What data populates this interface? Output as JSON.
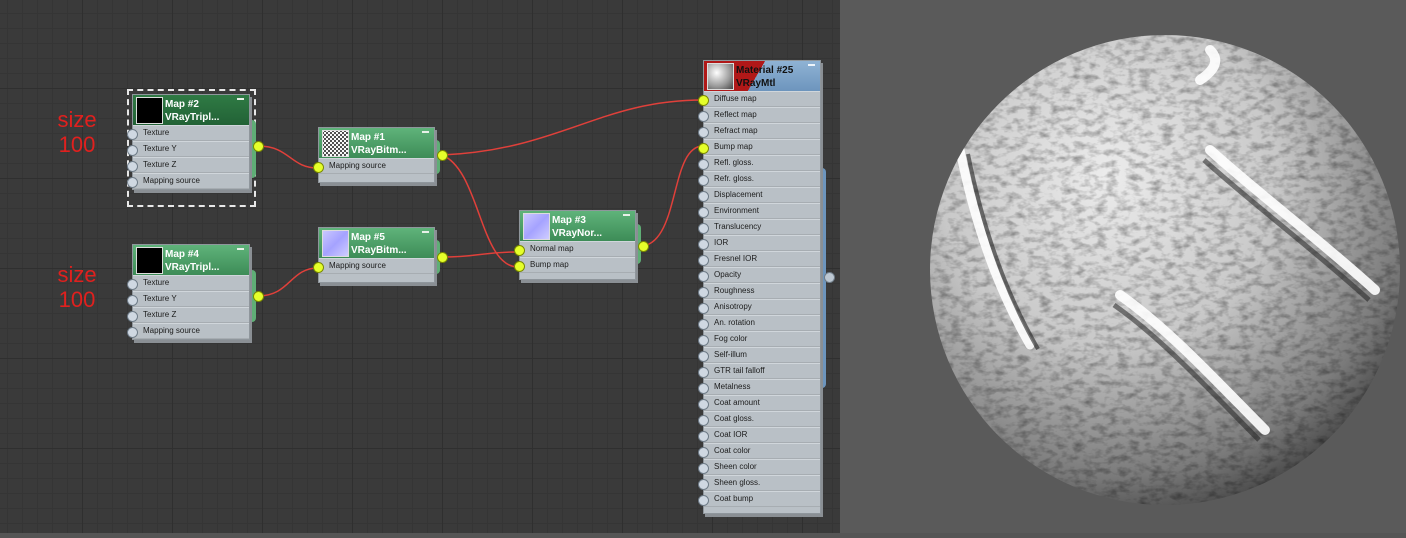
{
  "annotations": [
    {
      "size": "size",
      "value": "100"
    },
    {
      "size": "size",
      "value": "100"
    }
  ],
  "nodes": {
    "map2": {
      "title": "Map #2",
      "type": "VRayTripl...",
      "rows": [
        "Texture",
        "Texture Y",
        "Texture Z",
        "Mapping source"
      ]
    },
    "map4": {
      "title": "Map #4",
      "type": "VRayTripl...",
      "rows": [
        "Texture",
        "Texture Y",
        "Texture Z",
        "Mapping source"
      ]
    },
    "map1": {
      "title": "Map #1",
      "type": "VRayBitm...",
      "rows": [
        "Mapping source"
      ]
    },
    "map5": {
      "title": "Map #5",
      "type": "VRayBitm...",
      "rows": [
        "Mapping source"
      ]
    },
    "map3": {
      "title": "Map #3",
      "type": "VRayNor...",
      "rows": [
        "Normal map",
        "Bump map"
      ]
    },
    "material": {
      "title": "Material #25",
      "type": "VRayMtl",
      "rows": [
        "Diffuse map",
        "Reflect map",
        "Refract map",
        "Bump map",
        "Refl. gloss.",
        "Refr. gloss.",
        "Displacement",
        "Environment",
        "Translucency",
        "IOR",
        "Fresnel IOR",
        "Opacity",
        "Roughness",
        "Anisotropy",
        "An. rotation",
        "Fog color",
        "Self-illum",
        "GTR tail falloff",
        "Metalness",
        "Coat amount",
        "Coat gloss.",
        "Coat IOR",
        "Coat color",
        "Sheen color",
        "Sheen gloss.",
        "Coat bump"
      ]
    }
  },
  "colors": {
    "wire": "#e0403a",
    "active_socket": "#e5ff2a",
    "node_header": "#4fa068",
    "material_header": "#7aa1c6",
    "annotation": "#e0201e"
  }
}
